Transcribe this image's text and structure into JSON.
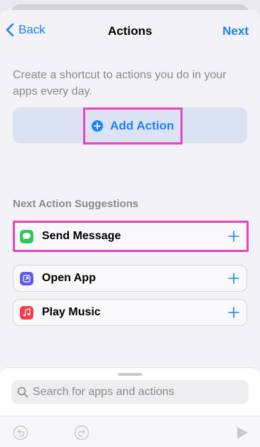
{
  "nav": {
    "back_label": "Back",
    "title": "Actions",
    "next_label": "Next"
  },
  "intro": {
    "description": "Create a shortcut to actions you do in your apps every day."
  },
  "add_action": {
    "label": "Add Action",
    "icon": "plus-circle-icon"
  },
  "suggestions": {
    "title": "Next Action Suggestions",
    "items": [
      {
        "label": "Send Message",
        "icon": "messages-app-icon",
        "color": "#34c759",
        "highlighted": true
      },
      {
        "label": "Open App",
        "icon": "open-app-icon",
        "color": "#5e5ce6",
        "highlighted": false
      },
      {
        "label": "Play Music",
        "icon": "music-app-icon",
        "color": "#fa3c4c",
        "highlighted": false
      }
    ]
  },
  "search": {
    "placeholder": "Search for apps and actions",
    "icon": "search-icon"
  },
  "toolbar": {
    "undo_icon": "undo-icon",
    "redo_icon": "redo-icon",
    "run_icon": "play-icon"
  },
  "colors": {
    "accent": "#1a82f7",
    "highlight": "#e843be",
    "add_action_bg": "#dbe2f1",
    "secondary_text": "#8a8a8e"
  }
}
